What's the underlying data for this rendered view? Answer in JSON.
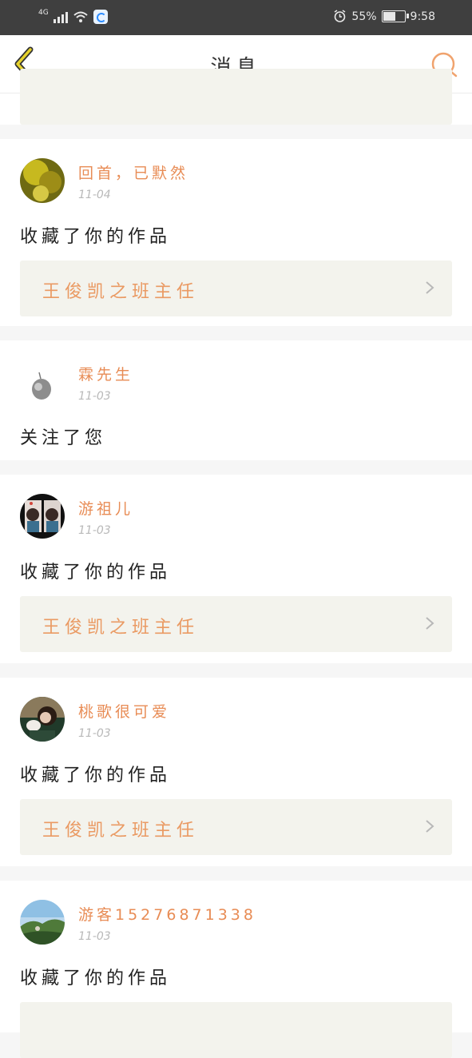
{
  "status_bar": {
    "network": "4G",
    "battery": "55%",
    "battery_level": 0.55,
    "time": "9:58"
  },
  "header": {
    "title": "消息"
  },
  "colors": {
    "accent": "#e88c55",
    "back_icon": "#e6d22c"
  },
  "icons": {
    "back": "back-arrow-icon",
    "search": "search-icon",
    "chevron": "chevron-right-icon"
  },
  "messages": [
    {
      "user": "回首，已默然",
      "date": "11-04",
      "action": "收藏了你的作品",
      "work": "王俊凯之班主任"
    },
    {
      "user": "霖先生",
      "date": "11-03",
      "action": "关注了您"
    },
    {
      "user": "游祖儿",
      "date": "11-03",
      "action": "收藏了你的作品",
      "work": "王俊凯之班主任"
    },
    {
      "user": "桃歌很可爱",
      "date": "11-03",
      "action": "收藏了你的作品",
      "work": "王俊凯之班主任"
    },
    {
      "user": "游客15276871338",
      "date": "11-03",
      "action": "收藏了你的作品"
    }
  ]
}
